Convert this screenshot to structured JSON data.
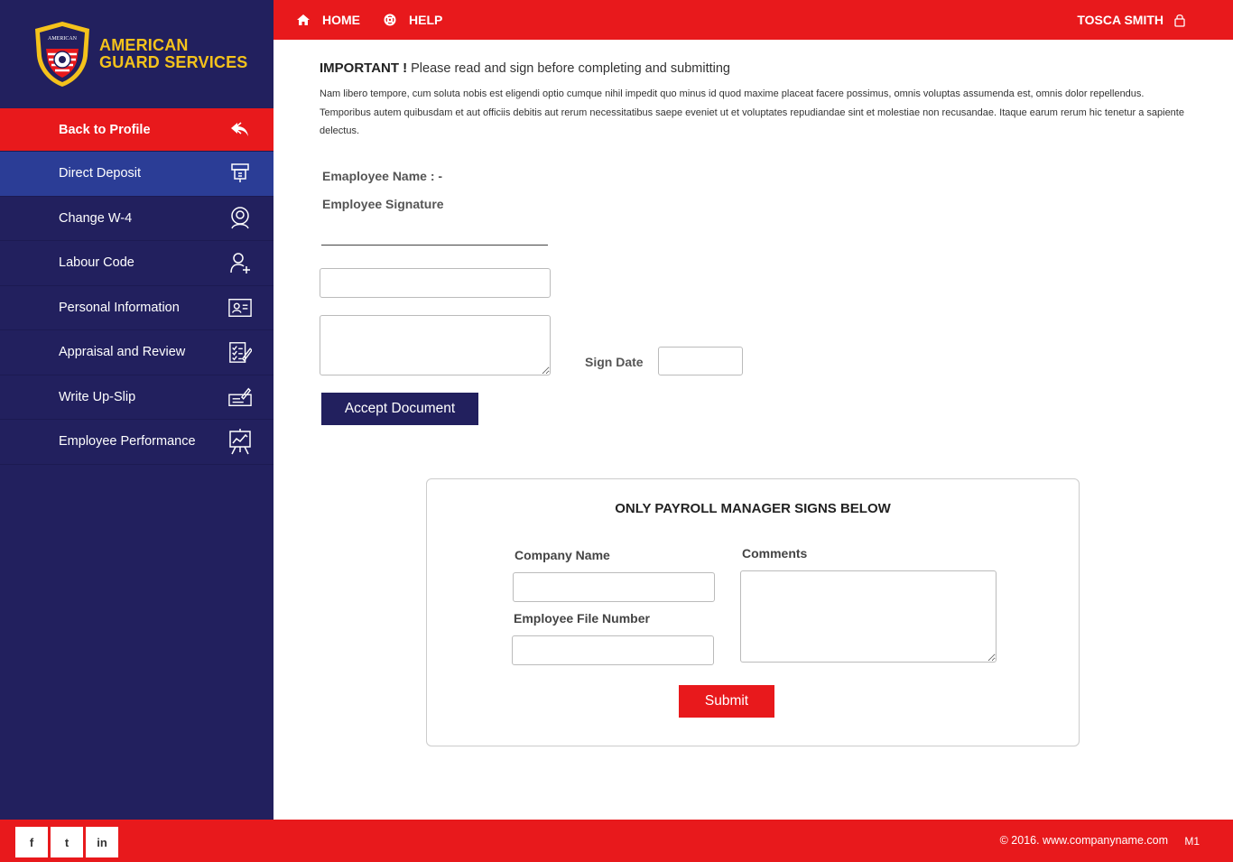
{
  "brand": {
    "line1": "AMERICAN",
    "line2": "GUARD SERVICES",
    "seal_text": "AMERICAN"
  },
  "colors": {
    "sidebar": "#22205e",
    "accent": "#e8191c",
    "active": "#2b3d96",
    "gold": "#f4c21b"
  },
  "sidebar": {
    "items": [
      {
        "label": "Back to Profile",
        "icon": "reply-icon"
      },
      {
        "label": "Direct Deposit",
        "icon": "deposit-icon"
      },
      {
        "label": "Change W-4",
        "icon": "user-outline-icon"
      },
      {
        "label": "Labour Code",
        "icon": "user-add-icon"
      },
      {
        "label": "Personal Information",
        "icon": "id-card-icon"
      },
      {
        "label": "Appraisal and Review",
        "icon": "checklist-icon"
      },
      {
        "label": "Write Up-Slip",
        "icon": "write-slip-icon"
      },
      {
        "label": "Employee Performance",
        "icon": "presentation-icon"
      }
    ]
  },
  "topbar": {
    "home": "HOME",
    "help": "HELP",
    "user": "TOSCA SMITH"
  },
  "main": {
    "important_label": "IMPORTANT",
    "important_mark": "!",
    "important_text": "Please read and sign before completing and submitting",
    "lorem": "Nam libero tempore, cum soluta nobis est eligendi optio cumque nihil impedit quo minus id quod maxime placeat facere possimus, omnis voluptas assumenda est, omnis dolor repellendus. Temporibus autem quibusdam et aut officiis debitis aut rerum necessitatibus saepe eveniet ut et voluptates repudiandae sint et molestiae non recusandae. Itaque earum rerum hic tenetur a sapiente delectus.",
    "employee_name_label": "Emaployee Name : -",
    "employee_signature_label": "Employee Signature",
    "sign_date_label": "Sign Date",
    "accept_button": "Accept Document"
  },
  "payroll": {
    "title": "ONLY PAYROLL MANAGER SIGNS BELOW",
    "company_label": "Company Name",
    "file_label": "Employee File Number",
    "comments_label": "Comments",
    "submit_button": "Submit"
  },
  "footer": {
    "social": [
      "f",
      "t",
      "in"
    ],
    "copyright": "© 2016. www.companyname.com",
    "version": "M1"
  }
}
